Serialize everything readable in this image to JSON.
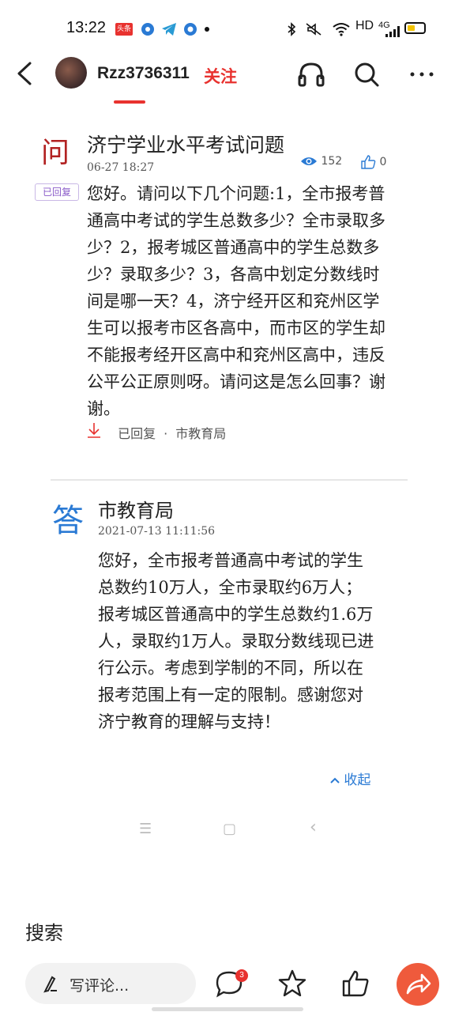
{
  "status_bar": {
    "time": "13:22",
    "toutiao_label": "头条",
    "network": "HD",
    "signal": "4G"
  },
  "header": {
    "username": "Rzz3736311",
    "follow_label": "关注"
  },
  "question": {
    "mark": "问",
    "title": "济宁学业水平考试问题",
    "date": "06-27  18:27",
    "views": "152",
    "likes": "0",
    "status_badge": "已回复",
    "body": "您好。请问以下几个问题:1，全市报考普通高中考试的学生总数多少？全市录取多少？2，报考城区普通高中的学生总数多少？录取多少？3，各高中划定分数线时间是哪一天？4，济宁经开区和兖州区学生可以报考市区各高中，而市区的学生却不能报考经开区高中和兖州区高中，违反公平公正原则呀。请问这是怎么回事？谢谢。",
    "footer_status": "已回复",
    "footer_dot": "·",
    "footer_org": "市教育局"
  },
  "answer": {
    "mark": "答",
    "title": "市教育局",
    "date": "2021-07-13  11:11:56",
    "body": "您好，全市报考普通高中考试的学生总数约10万人，全市录取约6万人；报考城区普通高中的学生总数约1.6万人，录取约1万人。录取分数线现已进行公示。考虑到学制的不同，所以在报考范围上有一定的限制。感谢您对济宁教育的理解与支持！",
    "collapse_label": "收起"
  },
  "soft_nav": {
    "menu": "☰",
    "home": "▢",
    "back": "‹"
  },
  "search_label": "搜索",
  "bottom_bar": {
    "comment_placeholder": "写评论...",
    "comment_count": "3"
  },
  "colors": {
    "accent_red": "#e8322f",
    "answer_blue": "#2a7ad4",
    "question_red": "#b22222"
  }
}
